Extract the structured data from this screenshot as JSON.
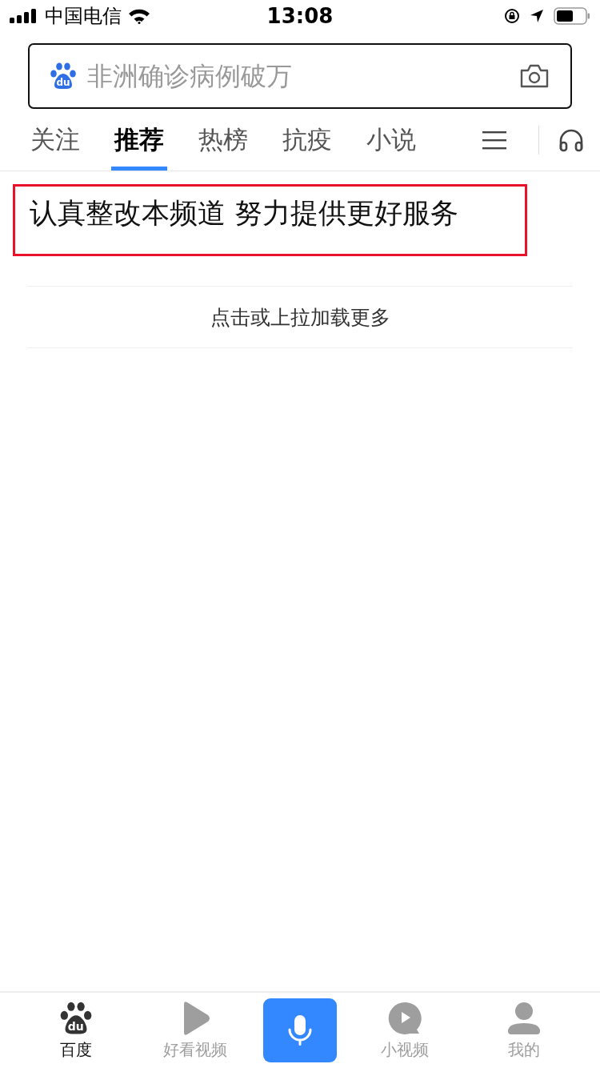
{
  "status_bar": {
    "carrier": "中国电信",
    "time": "13:08"
  },
  "search": {
    "logo": "du",
    "placeholder": "非洲确诊病例破万"
  },
  "tabs": [
    {
      "label": "关注",
      "selected": false
    },
    {
      "label": "推荐",
      "selected": true
    },
    {
      "label": "热榜",
      "selected": false
    },
    {
      "label": "抗疫",
      "selected": false
    },
    {
      "label": "小说",
      "selected": false
    }
  ],
  "notice": "认真整改本频道 努力提供更好服务",
  "load_more": "点击或上拉加载更多",
  "bottom_nav": [
    {
      "kind": "paw",
      "logo": "du",
      "label": "百度",
      "selected": true
    },
    {
      "kind": "play",
      "label": "好看视频",
      "selected": false
    },
    {
      "kind": "mic"
    },
    {
      "kind": "video",
      "label": "小视频",
      "selected": false
    },
    {
      "kind": "person",
      "label": "我的",
      "selected": false
    }
  ]
}
